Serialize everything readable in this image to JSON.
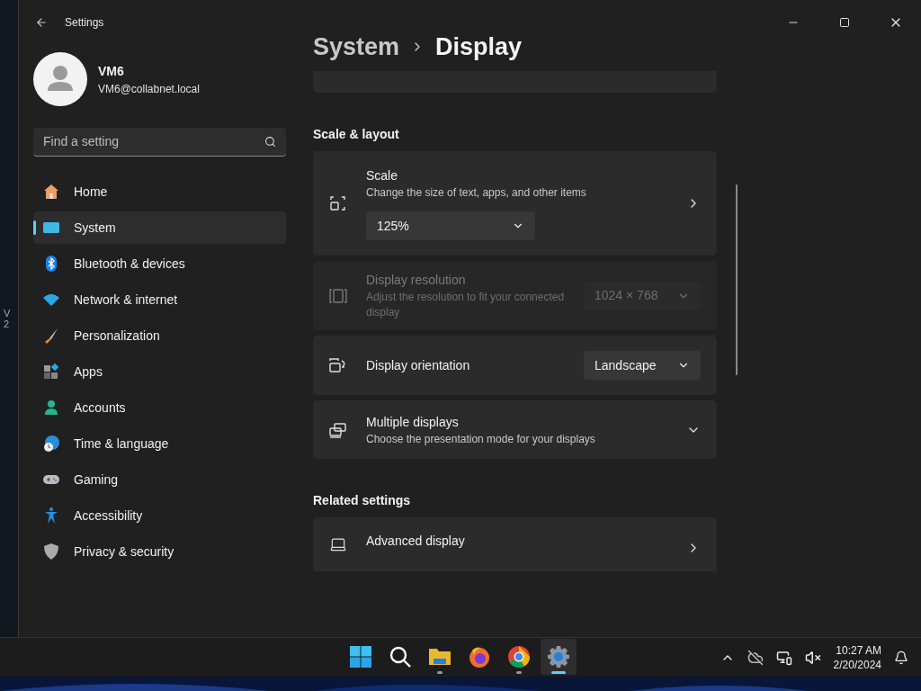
{
  "desktop_text": [
    "V",
    "2"
  ],
  "window": {
    "title": "Settings"
  },
  "profile": {
    "name": "VM6",
    "email": "VM6@collabnet.local"
  },
  "search": {
    "placeholder": "Find a setting"
  },
  "nav": [
    {
      "label": "Home",
      "selected": false
    },
    {
      "label": "System",
      "selected": true
    },
    {
      "label": "Bluetooth & devices",
      "selected": false
    },
    {
      "label": "Network & internet",
      "selected": false
    },
    {
      "label": "Personalization",
      "selected": false
    },
    {
      "label": "Apps",
      "selected": false
    },
    {
      "label": "Accounts",
      "selected": false
    },
    {
      "label": "Time & language",
      "selected": false
    },
    {
      "label": "Gaming",
      "selected": false
    },
    {
      "label": "Accessibility",
      "selected": false
    },
    {
      "label": "Privacy & security",
      "selected": false
    }
  ],
  "breadcrumb": [
    "System",
    "Display"
  ],
  "sections": [
    {
      "heading": "Scale & layout",
      "cards": [
        {
          "kind": "dropdown-below",
          "title": "Scale",
          "description": "Change the size of text, apps, and other items",
          "value": "125%",
          "disabled": false
        },
        {
          "kind": "dropdown",
          "title": "Display resolution",
          "description": "Adjust the resolution to fit your connected display",
          "value": "1024 × 768",
          "disabled": true
        },
        {
          "kind": "dropdown",
          "title": "Display orientation",
          "value": "Landscape",
          "disabled": false
        },
        {
          "kind": "expander",
          "title": "Multiple displays",
          "description": "Choose the presentation mode for your displays",
          "expanded": false
        }
      ]
    },
    {
      "heading": "Related settings",
      "cards": [
        {
          "kind": "link",
          "title": "Advanced display"
        }
      ]
    }
  ],
  "taskbar": {
    "apps": [
      {
        "kind": "start",
        "running": false,
        "active": false
      },
      {
        "kind": "search",
        "running": false,
        "active": false
      },
      {
        "kind": "explorer",
        "running": true,
        "active": false
      },
      {
        "kind": "firefox",
        "running": false,
        "active": false
      },
      {
        "kind": "chrome",
        "running": true,
        "active": false
      },
      {
        "kind": "settings",
        "running": true,
        "active": true
      }
    ],
    "time": "10:27 AM",
    "date": "2/20/2024"
  }
}
